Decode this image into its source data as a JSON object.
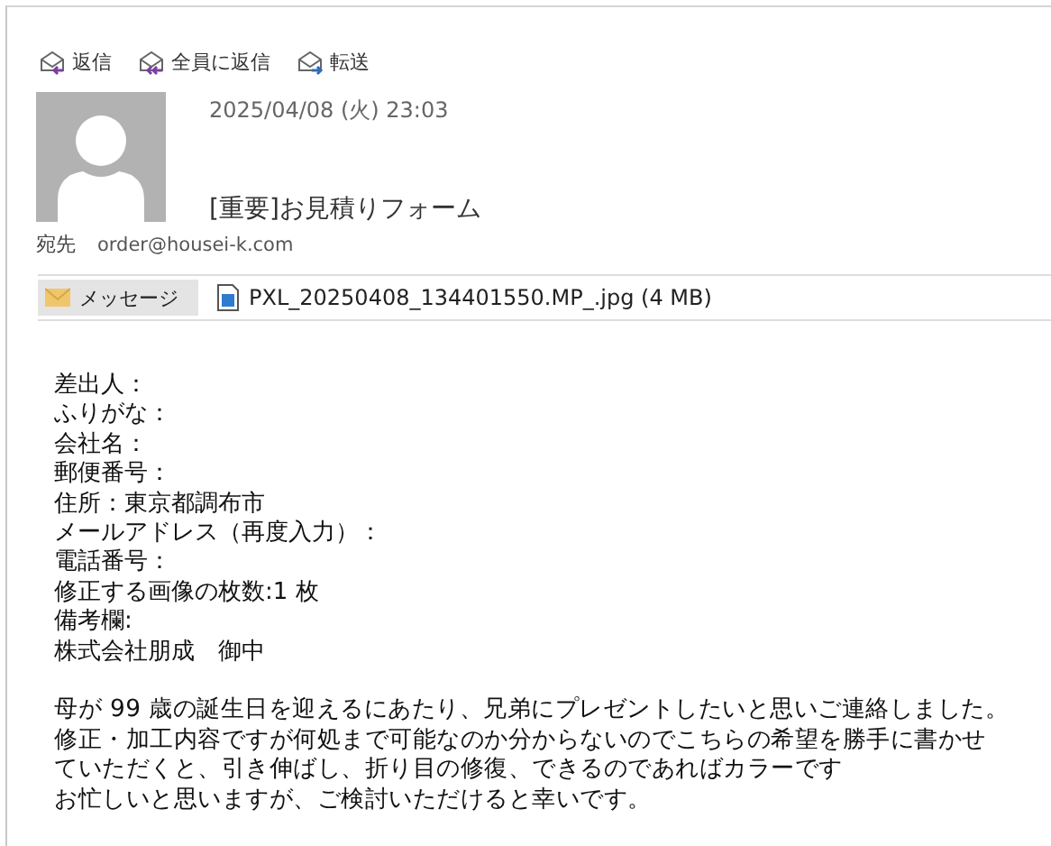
{
  "toolbar": [
    {
      "kind": "reply",
      "label": "返信"
    },
    {
      "kind": "reply_all",
      "label": "全員に返信"
    },
    {
      "kind": "forward",
      "label": "転送"
    }
  ],
  "header": {
    "date": "2025/04/08 (火) 23:03",
    "subject": "[重要]お見積りフォーム",
    "to_label": "宛先",
    "to": "order@housei-k.com"
  },
  "attachments": [
    {
      "kind": "message",
      "label": "メッセージ",
      "selected": true
    },
    {
      "kind": "file",
      "label": "PXL_20250408_134401550.MP_.jpg (4 MB)",
      "selected": false
    }
  ],
  "body": {
    "fields": [
      "差出人：",
      "ふりがな：",
      "会社名：",
      "郵便番号：",
      "住所：東京都調布市",
      "メールアドレス（再度入力）：",
      "電話番号：",
      "修正する画像の枚数:1 枚",
      "備考欄:",
      "株式会社朋成　御中"
    ],
    "message_lines": [
      "母が 99 歳の誕生日を迎えるにあたり、兄弟にプレゼントしたいと思いご連絡しました。",
      "修正・加工内容ですが何処まで可能なのか分からないのでこちらの希望を勝手に書かせ",
      "ていただくと、引き伸ばし、折り目の修復、できるのであればカラーです",
      "お忙しいと思いますが、ご検討いただけると幸いです。"
    ]
  }
}
